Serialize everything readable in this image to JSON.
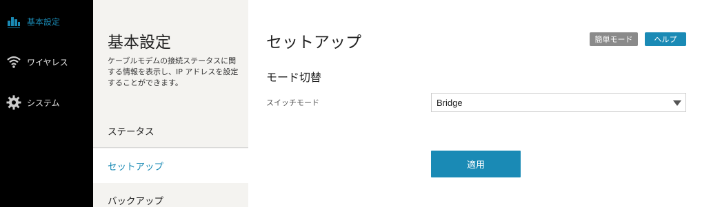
{
  "nav": {
    "items": [
      {
        "label": "基本設定",
        "icon": "bar-chart-icon",
        "active": true
      },
      {
        "label": "ワイヤレス",
        "icon": "wifi-icon",
        "active": false
      },
      {
        "label": "システム",
        "icon": "gear-icon",
        "active": false
      }
    ]
  },
  "subnav": {
    "title": "基本設定",
    "description": "ケーブルモデムの接続ステータスに関する情報を表示し、IP アドレスを設定することができます。",
    "items": [
      {
        "label": "ステータス"
      },
      {
        "label": "セットアップ"
      },
      {
        "label": "バックアップ"
      }
    ]
  },
  "main": {
    "title": "セットアップ",
    "simple_mode_label": "簡単モード",
    "help_label": "ヘルプ",
    "section_title": "モード切替",
    "switch_mode_label": "スイッチモード",
    "switch_mode_value": "Bridge",
    "apply_label": "適用"
  },
  "colors": {
    "accent": "#1a8ab5",
    "nav_bg": "#000000",
    "subnav_bg": "#f4f3f0",
    "badge_grey": "#8a8a8a"
  }
}
